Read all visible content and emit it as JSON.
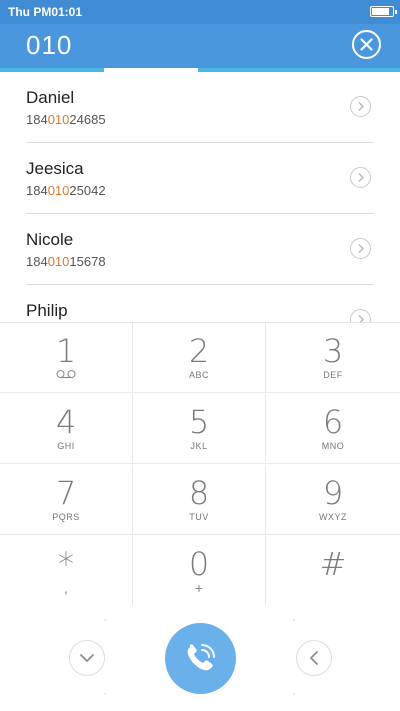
{
  "status_bar": {
    "time": "Thu PM01:01",
    "battery_level": 0.9
  },
  "header": {
    "dialed": "010",
    "clear_icon": "close-circle-icon"
  },
  "contacts": [
    {
      "name": "Daniel",
      "number_pre": "184",
      "number_match": "010",
      "number_post": "24685"
    },
    {
      "name": "Jeesica",
      "number_pre": "184",
      "number_match": "010",
      "number_post": "25042"
    },
    {
      "name": "Nicole",
      "number_pre": "184",
      "number_match": "010",
      "number_post": "15678"
    },
    {
      "name": "Philip",
      "number_pre": "",
      "number_match": "",
      "number_post": ""
    }
  ],
  "keypad": {
    "keys": [
      {
        "digit": "1",
        "letters": "",
        "icon": "voicemail-icon"
      },
      {
        "digit": "2",
        "letters": "ABC"
      },
      {
        "digit": "3",
        "letters": "DEF"
      },
      {
        "digit": "4",
        "letters": "GHI"
      },
      {
        "digit": "5",
        "letters": "JKL"
      },
      {
        "digit": "6",
        "letters": "MNO"
      },
      {
        "digit": "7",
        "letters": "PQRS"
      },
      {
        "digit": "8",
        "letters": "TUV"
      },
      {
        "digit": "9",
        "letters": "WXYZ"
      },
      {
        "digit": "*",
        "sub": ","
      },
      {
        "digit": "0",
        "sub": "+"
      },
      {
        "digit": "#",
        "sub": ""
      }
    ]
  },
  "bottom": {
    "collapse_icon": "chevron-down-icon",
    "call_icon": "phone-call-icon",
    "backspace_icon": "chevron-left-icon"
  },
  "colors": {
    "header": "#4a97de",
    "status_bar": "#3f8bd4",
    "match_highlight": "#e0792a",
    "call_button": "#6ab0ea"
  }
}
